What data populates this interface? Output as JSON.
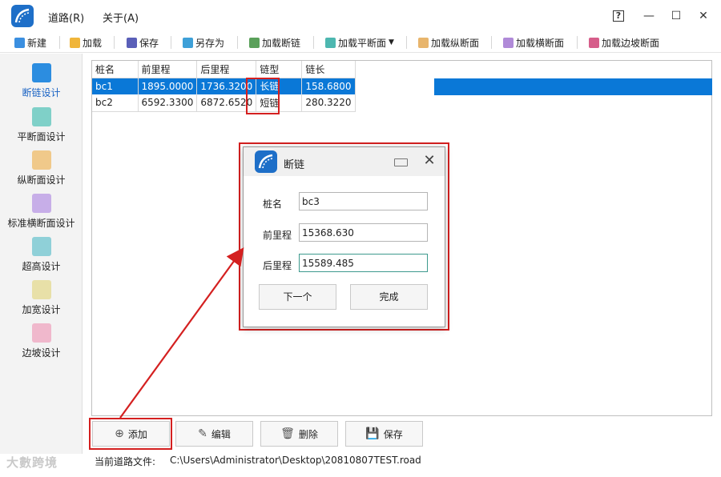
{
  "menu": {
    "road": "道路(R)",
    "about": "关于(A)"
  },
  "window_controls": {
    "help": "?",
    "minimize": "—",
    "maximize": "☐",
    "close": "✕"
  },
  "toolbar": {
    "new": "新建",
    "load": "加载",
    "save": "保存",
    "save_as": "另存为",
    "load_broken_chain": "加载断链",
    "load_plan": "加载平断面",
    "load_profile": "加载纵断面",
    "load_cross": "加载横断面",
    "load_slope": "加载边坡断面"
  },
  "sidebar": {
    "items": [
      {
        "label": "断链设计",
        "active": true
      },
      {
        "label": "平断面设计"
      },
      {
        "label": "纵断面设计"
      },
      {
        "label": "标准横断面设计"
      },
      {
        "label": "超高设计"
      },
      {
        "label": "加宽设计"
      },
      {
        "label": "边坡设计"
      }
    ]
  },
  "table": {
    "columns": [
      "桩名",
      "前里程",
      "后里程",
      "链型",
      "链长"
    ],
    "rows": [
      [
        "bc1",
        "1895.0000",
        "1736.3200",
        "长链",
        "158.6800"
      ],
      [
        "bc2",
        "6592.3300",
        "6872.6520",
        "短链",
        "280.3220"
      ]
    ]
  },
  "dialog": {
    "title": "断链",
    "fields": {
      "name_label": "桩名",
      "name_value": "bc3",
      "front_label": "前里程",
      "front_value": "15368.630",
      "back_label": "后里程",
      "back_value": "15589.485"
    },
    "next_button": "下一个",
    "done_button": "完成"
  },
  "actions": {
    "add": "添加",
    "edit": "编辑",
    "delete": "删除",
    "save": "保存"
  },
  "status": {
    "label": "当前道路文件:",
    "path": "C:\\Users\\Administrator\\Desktop\\20810807TEST.road"
  },
  "watermark": "大數跨境",
  "colors": {
    "selection": "#0a78d7",
    "highlight_red": "#d42020",
    "logo_blue": "#1e6fc8"
  }
}
